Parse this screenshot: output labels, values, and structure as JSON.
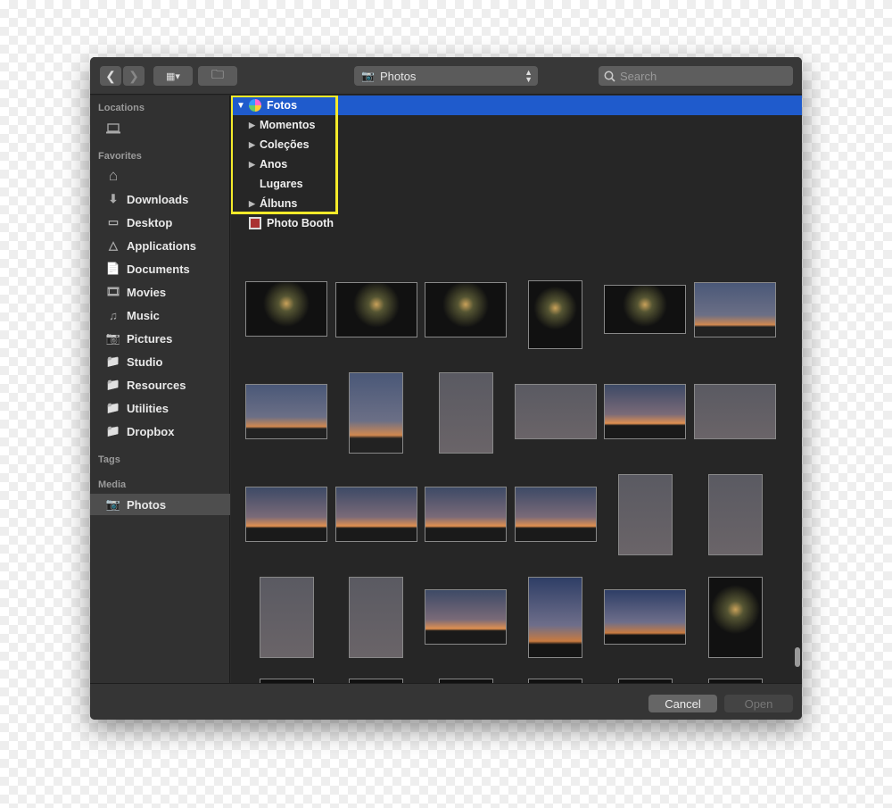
{
  "toolbar": {
    "location": "Photos",
    "search_placeholder": "Search"
  },
  "sidebar": {
    "locations_label": "Locations",
    "favorites_label": "Favorites",
    "favorites": [
      {
        "label": "Downloads",
        "icon": "download-icon"
      },
      {
        "label": "Desktop",
        "icon": "desktop-icon"
      },
      {
        "label": "Applications",
        "icon": "applications-icon"
      },
      {
        "label": "Documents",
        "icon": "documents-icon"
      },
      {
        "label": "Movies",
        "icon": "film-icon"
      },
      {
        "label": "Music",
        "icon": "music-icon"
      },
      {
        "label": "Pictures",
        "icon": "camera-icon"
      },
      {
        "label": "Studio",
        "icon": "folder-icon"
      },
      {
        "label": "Resources",
        "icon": "folder-icon"
      },
      {
        "label": "Utilities",
        "icon": "folder-icon"
      },
      {
        "label": "Dropbox",
        "icon": "folder-icon"
      }
    ],
    "tags_label": "Tags",
    "media_label": "Media",
    "media": [
      {
        "label": "Photos",
        "icon": "camera-icon"
      }
    ]
  },
  "tree": {
    "root": "Fotos",
    "children": [
      {
        "label": "Momentos",
        "expandable": true
      },
      {
        "label": "Coleções",
        "expandable": true
      },
      {
        "label": "Anos",
        "expandable": true
      },
      {
        "label": "Lugares",
        "expandable": false
      },
      {
        "label": "Álbuns",
        "expandable": true
      }
    ],
    "photo_booth": "Photo Booth"
  },
  "colors": {
    "selection": "#1f5bcc",
    "highlight": "#f4ea2a"
  },
  "footer": {
    "cancel": "Cancel",
    "open": "Open"
  }
}
